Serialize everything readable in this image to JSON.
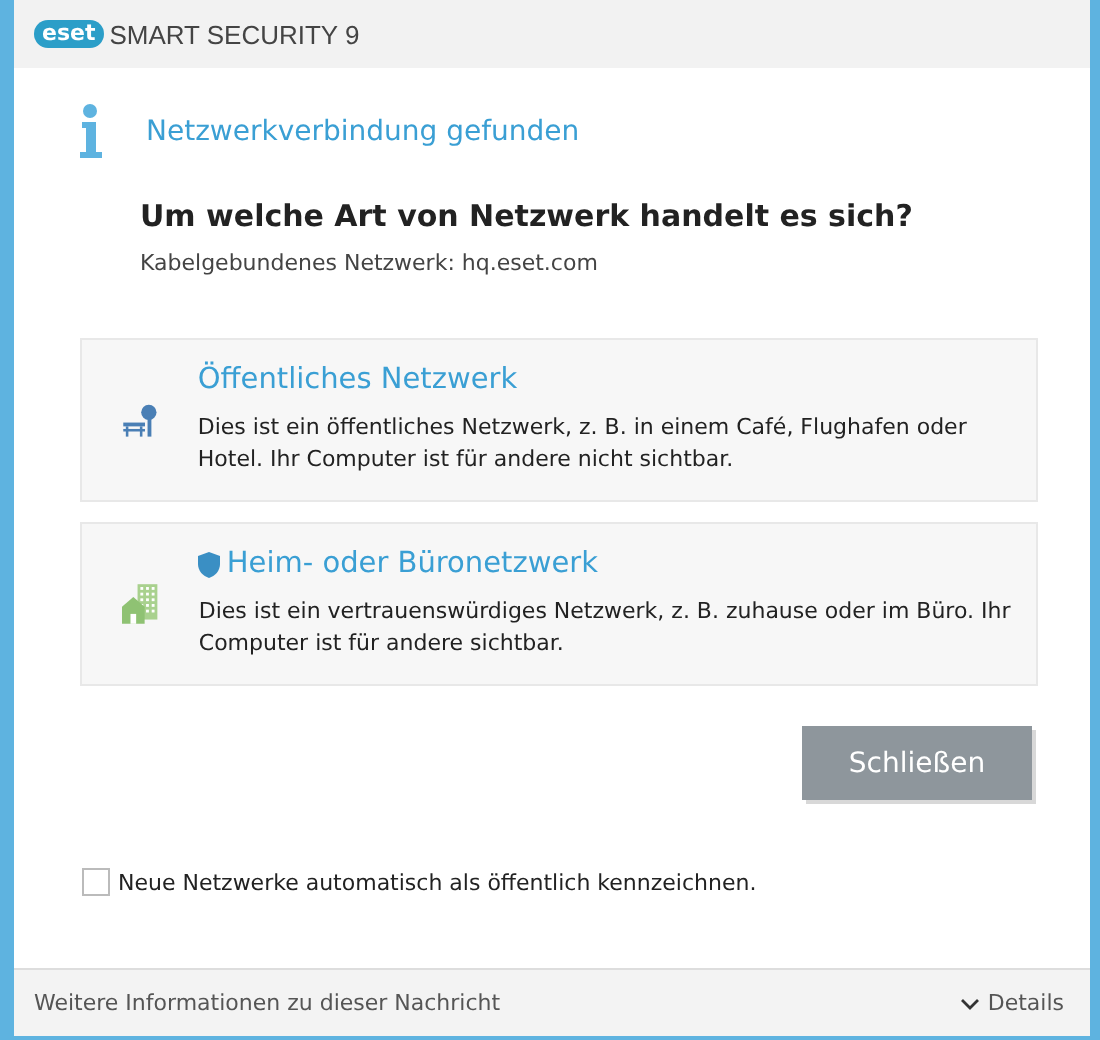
{
  "window": {
    "logo": "eset",
    "title": "SMART SECURITY 9"
  },
  "notice": {
    "title": "Netzwerkverbindung gefunden"
  },
  "question": "Um welche Art von Netzwerk handelt es sich?",
  "connection": "Kabelgebundenes Netzwerk: hq.eset.com",
  "options": [
    {
      "kind": "public",
      "title": "Öffentliches Netzwerk",
      "description": "Dies ist ein öffentliches Netzwerk, z. B. in einem Café, Flughafen oder Hotel. Ihr Computer ist für andere nicht sichtbar."
    },
    {
      "kind": "home",
      "title": "Heim- oder Büronetzwerk",
      "description": "Dies ist ein vertrauenswürdiges Netzwerk, z. B. zuhause oder im Büro. Ihr Computer ist für andere sichtbar."
    }
  ],
  "buttons": [
    "Schließen"
  ],
  "checkbox": {
    "label": "Neue Netzwerke automatisch als öffentlich kennzeichnen.",
    "checked": false
  },
  "footer": {
    "info": "Weitere Informationen zu dieser Nachricht",
    "details": "Details"
  }
}
